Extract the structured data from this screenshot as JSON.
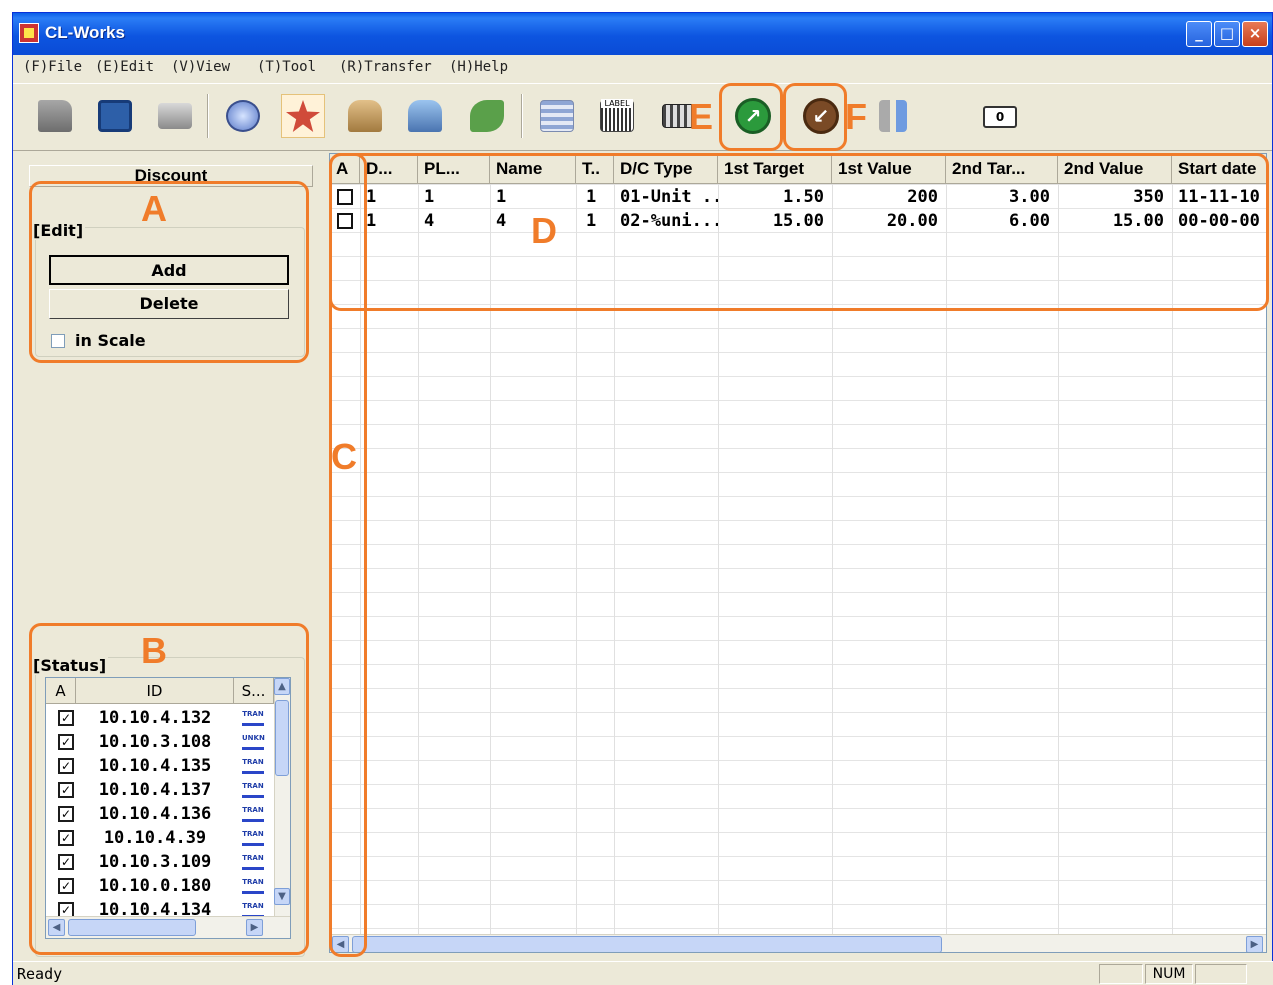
{
  "window": {
    "title": "CL-Works"
  },
  "menu": [
    "(F)File",
    "(E)Edit",
    "(V)View",
    "(T)Tool",
    "(R)Transfer",
    "(H)Help"
  ],
  "toolbar": {
    "icons": [
      "open-folder-icon",
      "save-disk-icon",
      "print-icon",
      "plu-icon",
      "discount-star-icon",
      "user-icon",
      "printer-user-icon",
      "recycle-icon",
      "list-icon",
      "label-icon",
      "keyboard-icon",
      "send-icon",
      "receive-icon",
      "settings-tools-icon"
    ],
    "label_icon_text": "LABEL",
    "counter": "0"
  },
  "annotations": {
    "a": "A",
    "b": "B",
    "c": "C",
    "d": "D",
    "e": "E",
    "f": "F"
  },
  "left_panel": {
    "header": "Discount",
    "edit_group": {
      "legend": "[Edit]",
      "add_label": "Add",
      "delete_label": "Delete",
      "in_scale_label": "in Scale",
      "in_scale_checked": false
    },
    "status_group": {
      "legend": "[Status]",
      "columns": [
        "A",
        "ID",
        "S..."
      ],
      "rows": [
        {
          "checked": true,
          "id": "10.10.4.132",
          "state": "TRAN"
        },
        {
          "checked": true,
          "id": "10.10.3.108",
          "state": "UNKN"
        },
        {
          "checked": true,
          "id": "10.10.4.135",
          "state": "TRAN"
        },
        {
          "checked": true,
          "id": "10.10.4.137",
          "state": "TRAN"
        },
        {
          "checked": true,
          "id": "10.10.4.136",
          "state": "TRAN"
        },
        {
          "checked": true,
          "id": "10.10.4.39",
          "state": "TRAN"
        },
        {
          "checked": true,
          "id": "10.10.3.109",
          "state": "TRAN"
        },
        {
          "checked": true,
          "id": "10.10.0.180",
          "state": "TRAN"
        },
        {
          "checked": true,
          "id": "10.10.4.134",
          "state": "TRAN"
        }
      ]
    }
  },
  "grid": {
    "columns": [
      "A",
      "D...",
      "PL...",
      "Name",
      "T..",
      "D/C Type",
      "1st Target",
      "1st Value",
      "2nd Tar...",
      "2nd Value",
      "Start date"
    ],
    "rows": [
      {
        "a": "",
        "d": "1",
        "pl": "1",
        "name": "1",
        "t": "1",
        "dc_type": "01-Unit ...",
        "target1": "1.50",
        "value1": "200",
        "target2": "3.00",
        "value2": "350",
        "start": "11-11-10"
      },
      {
        "a": "",
        "d": "1",
        "pl": "4",
        "name": "4",
        "t": "1",
        "dc_type": "02-%uni...",
        "target1": "15.00",
        "value1": "20.00",
        "target2": "6.00",
        "value2": "15.00",
        "start": "00-00-00"
      }
    ]
  },
  "statusbar": {
    "text": "Ready",
    "num": "NUM"
  }
}
